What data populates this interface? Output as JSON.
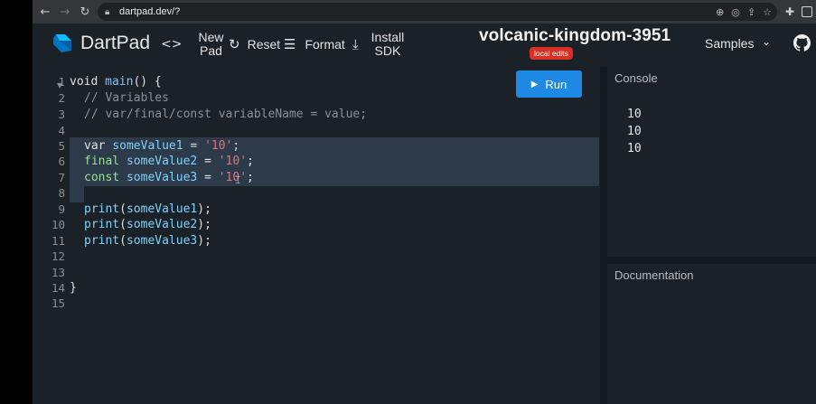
{
  "browser": {
    "url": "dartpad.dev/?",
    "back_icon": "arrow-left-icon",
    "forward_icon": "arrow-right-icon",
    "reload_icon": "reload-icon"
  },
  "toolbar": {
    "brand": "DartPad",
    "new_pad_line1": "New",
    "new_pad_line2": "Pad",
    "reset_label": "Reset",
    "format_label": "Format",
    "install_line1": "Install",
    "install_line2": "SDK",
    "pad_title": "volcanic-kingdom-3951",
    "badge": "local edits",
    "samples_label": "Samples"
  },
  "run": {
    "label": "Run"
  },
  "editor": {
    "line_numbers": [
      "1",
      "2",
      "3",
      "4",
      "5",
      "6",
      "7",
      "8",
      "9",
      "10",
      "11",
      "12",
      "13",
      "14",
      "15"
    ],
    "lines": {
      "l1_kw": "void",
      "l1_fn": "main",
      "l1_rest": "() {",
      "l2": "// Variables",
      "l3": "// var/final/const variableName = value;",
      "l5_kw": "var",
      "l5_name": "someValue1",
      "l5_eq": " = ",
      "l5_str": "'10'",
      "l5_end": ";",
      "l6_kw": "final",
      "l6_name": "someValue2",
      "l6_eq": " = ",
      "l6_str": "'10'",
      "l6_end": ";",
      "l7_kw": "const",
      "l7_name": "someValue3",
      "l7_eq": " = ",
      "l7_str": "'10'",
      "l7_end": ";",
      "l9_fn": "print",
      "l9_arg": "someValue1",
      "l10_fn": "print",
      "l10_arg": "someValue2",
      "l11_fn": "print",
      "l11_arg": "someValue3",
      "l14": "}"
    }
  },
  "console": {
    "title": "Console",
    "output": [
      "10",
      "10",
      "10"
    ]
  },
  "documentation": {
    "title": "Documentation"
  },
  "colors": {
    "run_button": "#1e88e5",
    "badge": "#d93025",
    "selection": "#2c3a4a",
    "string": "#e57373",
    "keyword": "#7fd1ff"
  }
}
